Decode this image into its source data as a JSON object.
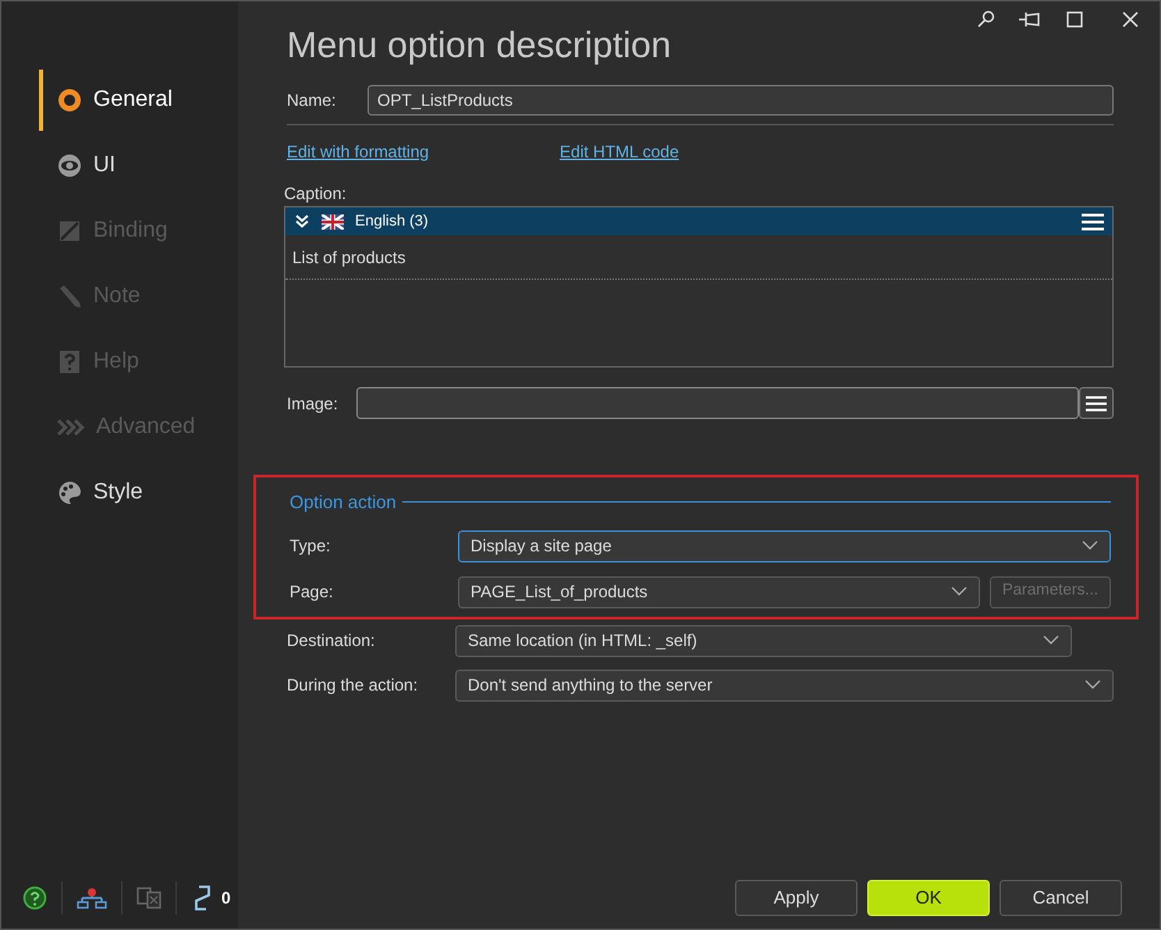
{
  "window": {
    "title": "Menu option description"
  },
  "sidebar": {
    "items": [
      {
        "label": "General",
        "selected": true,
        "disabled": false
      },
      {
        "label": "UI",
        "selected": false,
        "disabled": false
      },
      {
        "label": "Binding",
        "selected": false,
        "disabled": true
      },
      {
        "label": "Note",
        "selected": false,
        "disabled": true
      },
      {
        "label": "Help",
        "selected": false,
        "disabled": true
      },
      {
        "label": "Advanced",
        "selected": false,
        "disabled": true
      },
      {
        "label": "Style",
        "selected": false,
        "disabled": false
      }
    ]
  },
  "status_bar": {
    "link_count": "0"
  },
  "form": {
    "name": {
      "label": "Name:",
      "value": "OPT_ListProducts"
    },
    "links": [
      "Edit with formatting",
      "Edit HTML code"
    ],
    "caption": {
      "label": "Caption:",
      "language": "English (3)",
      "text": "List of products"
    },
    "image": {
      "label": "Image:"
    }
  },
  "option_action": {
    "title": "Option action",
    "highlighted": true,
    "fields": [
      {
        "label": "Type:",
        "value": "Display a site page",
        "focused": true
      },
      {
        "label": "Page:",
        "value": "PAGE_List_of_products",
        "focused": false,
        "button": {
          "label": "Parameters...",
          "disabled": true
        }
      }
    ]
  },
  "other_fields": [
    {
      "label": "Destination:",
      "value": "Same location (in HTML: _self)"
    },
    {
      "label": "During the action:",
      "value": "Don't send anything to the server"
    }
  ],
  "buttons": [
    {
      "label": "Apply",
      "default": false
    },
    {
      "label": "OK",
      "default": true
    },
    {
      "label": "Cancel",
      "default": false
    }
  ]
}
